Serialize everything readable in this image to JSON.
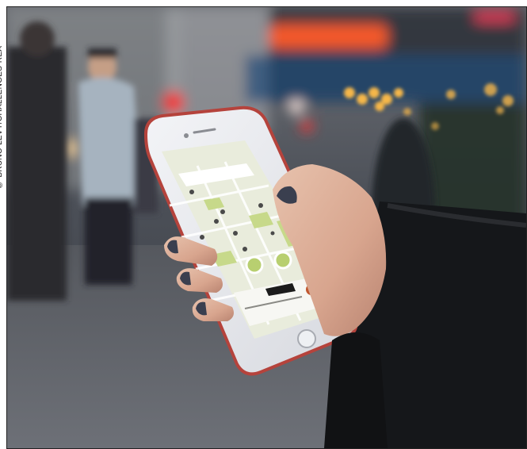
{
  "credit": "© BRUNO LEVY/CHALLENGES-REA",
  "colors": {
    "phone_frame": "#e7e9ee",
    "phone_edge": "#b5433c",
    "map_bg": "#e9ecdc",
    "map_green": "#c7d98a",
    "street_bg": "#4a4e55",
    "neon": "#ff5a2a",
    "bokeh": "#f6b74a"
  },
  "icons": [
    "home-button-icon",
    "speaker-icon",
    "camera-icon",
    "map-pin-icon"
  ]
}
